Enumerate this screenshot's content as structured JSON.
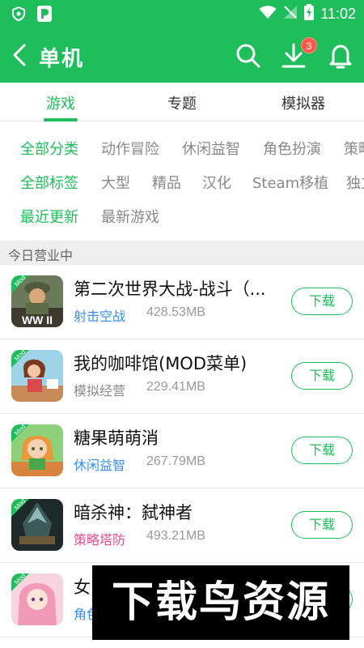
{
  "status_bar": {
    "time": "11:02"
  },
  "header": {
    "title": "单机",
    "download_badge": "3"
  },
  "tabs": [
    {
      "label": "游戏",
      "active": true
    },
    {
      "label": "专题",
      "active": false
    },
    {
      "label": "模拟器",
      "active": false
    }
  ],
  "filters": {
    "categories": [
      "全部分类",
      "动作冒险",
      "休闲益智",
      "角色扮演",
      "策略"
    ],
    "tags": [
      "全部标签",
      "大型",
      "精品",
      "汉化",
      "Steam移植",
      "独立"
    ],
    "sort": [
      "最近更新",
      "最新游戏"
    ]
  },
  "section": {
    "title": "今日营业中"
  },
  "apps": [
    {
      "name": "第二次世界大战-战斗（...",
      "category": "射击空战",
      "category_color": "#3a8ee6",
      "size": "428.53MB",
      "button": "下载",
      "icon": "ww2-soldier-icon",
      "icon_text": "WW II",
      "mod": "Mod"
    },
    {
      "name": "我的咖啡馆(MOD菜单)",
      "category": "模拟经营",
      "category_color": "#888888",
      "size": "229.41MB",
      "button": "下载",
      "icon": "cafe-girl-icon",
      "mod": "Mod"
    },
    {
      "name": "糖果萌萌消",
      "category": "休闲益智",
      "category_color": "#3a8ee6",
      "size": "267.79MB",
      "button": "下载",
      "icon": "candy-girl-icon",
      "mod": "Mod"
    },
    {
      "name": "暗杀神：弑神者",
      "category": "策略塔防",
      "category_color": "#e0508a",
      "size": "493.21MB",
      "button": "下载",
      "icon": "assassin-icon",
      "mod": "Mod"
    },
    {
      "name": "女",
      "category": "角色",
      "category_color": "#3a8ee6",
      "size": "",
      "button": "下载",
      "icon": "anime-girl-icon",
      "mod": "Mod"
    }
  ],
  "watermark": "下载鸟资源",
  "colors": {
    "brand_green": "#1fbd5b",
    "badge_red": "#ff5a4a"
  }
}
